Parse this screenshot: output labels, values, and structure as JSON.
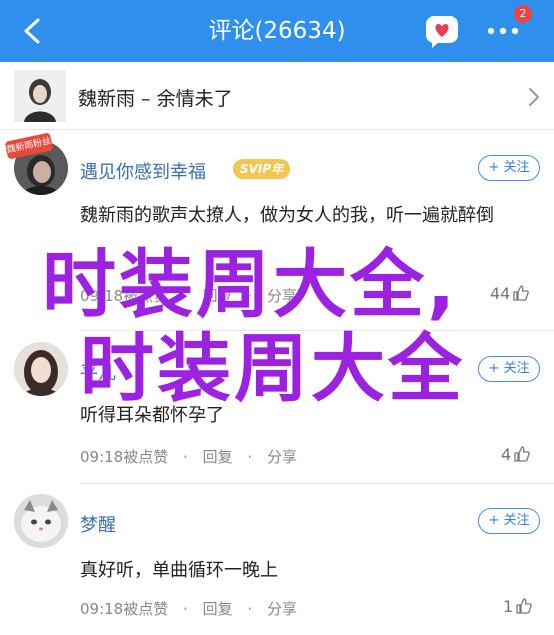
{
  "navbar": {
    "title": "评论(26634)",
    "badge_count": "2",
    "back_icon": "chevron-left-icon",
    "message_icon": "heart-chat-icon",
    "more_icon": "more-dots-icon",
    "bg_color": "#2f8fec"
  },
  "song": {
    "title": "魏新雨 – 余情未了"
  },
  "comments": [
    {
      "username": "遇见你感到幸福",
      "vip_label": "SVIP年",
      "avatar_badge": "魏新雨粉丝",
      "follow_label": "+ 关注",
      "text": "魏新雨的歌声太撩人，做为女人的我，听一遍就醉倒",
      "time": "09:18",
      "like_action": "被点赞",
      "reply": "回复",
      "share": "分享",
      "likes": "44"
    },
    {
      "username": "平凡",
      "follow_label": "+ 关注",
      "text": "听得耳朵都怀孕了",
      "time": "09:18",
      "like_action": "被点赞",
      "reply": "回复",
      "share": "分享",
      "likes": "4"
    },
    {
      "username": "梦醒",
      "follow_label": "+ 关注",
      "text": "真好听，单曲循环一晚上",
      "time": "09:18",
      "like_action": "被点赞",
      "reply": "回复",
      "share": "分享",
      "likes": "1"
    }
  ],
  "watermark": {
    "line1": "时装周大全,",
    "line2": "时装周大全",
    "color": "#9b22e0"
  }
}
